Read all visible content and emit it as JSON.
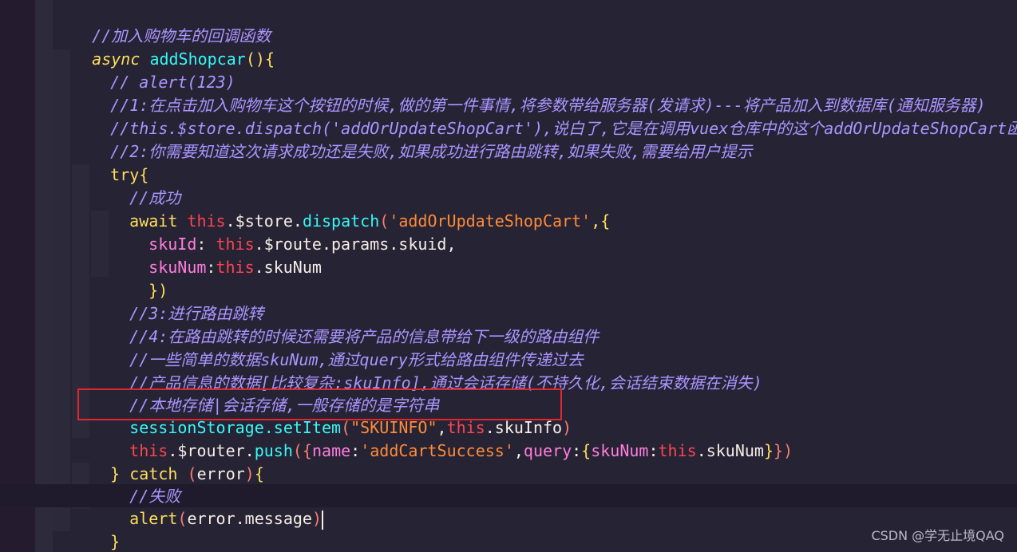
{
  "code": {
    "l1": "//加入购物车的回调函数",
    "l2_kw": "async",
    "l2_fn": "addShopcar",
    "l2_rest": "(){",
    "l3": "// alert(123)",
    "l4": "//1:在点击加入购物车这个按钮的时候,做的第一件事情,将参数带给服务器(发请求)---将产品加入到数据库(通知服务器)",
    "l5": "//this.$store.dispatch('addOrUpdateShopCart'),说白了,它是在调用vuex仓库中的这个addOrUpdateShopCart函数",
    "l6": "//2:你需要知道这次请求成功还是失败,如果成功进行路由跳转,如果失败,需要给用户提示",
    "l7_kw": "try",
    "l7_rest": "{",
    "l8": "//成功",
    "l9_await": "await",
    "l9_this": "this",
    "l9_store": ".$store.",
    "l9_dispatch": "dispatch",
    "l9_str": "'addOrUpdateShopCart'",
    "l9_rest": ",{",
    "l10_key": "skuId",
    "l10_this": "this",
    "l10_rest": ".$route.params.skuid,",
    "l11_key": "skuNum",
    "l11_this": "this",
    "l11_rest": ".skuNum",
    "l12": "})",
    "l13": "//3:进行路由跳转",
    "l14": "//4:在路由跳转的时候还需要将产品的信息带给下一级的路由组件",
    "l15": "//一些简单的数据skuNum,通过query形式给路由组件传递过去",
    "l16": "//产品信息的数据[比较复杂:skuInfo],通过会话存储(不持久化,会话结束数据在消失)",
    "l17": "//本地存储|会话存储,一般存储的是字符串",
    "l18_obj": "sessionStorage.",
    "l18_fn": "setItem",
    "l18_str": "\"SKUINFO\"",
    "l18_this": "this",
    "l18_rest": ".skuInfo",
    "l19_this": "this",
    "l19_router": ".$router.",
    "l19_fn": "push",
    "l19_name": "name",
    "l19_str": "'addCartSuccess'",
    "l19_query": "query",
    "l19_key": "skuNum",
    "l19_this2": "this",
    "l19_rest": ".skuNum",
    "l20_open": "} ",
    "l20_catch": "catch",
    "l20_err": "error",
    "l21": "//失败",
    "l22_fn": "alert",
    "l22_arg": "error.message",
    "l23": "}",
    "l24": "}"
  },
  "watermark": "CSDN @学无止境QAQ"
}
